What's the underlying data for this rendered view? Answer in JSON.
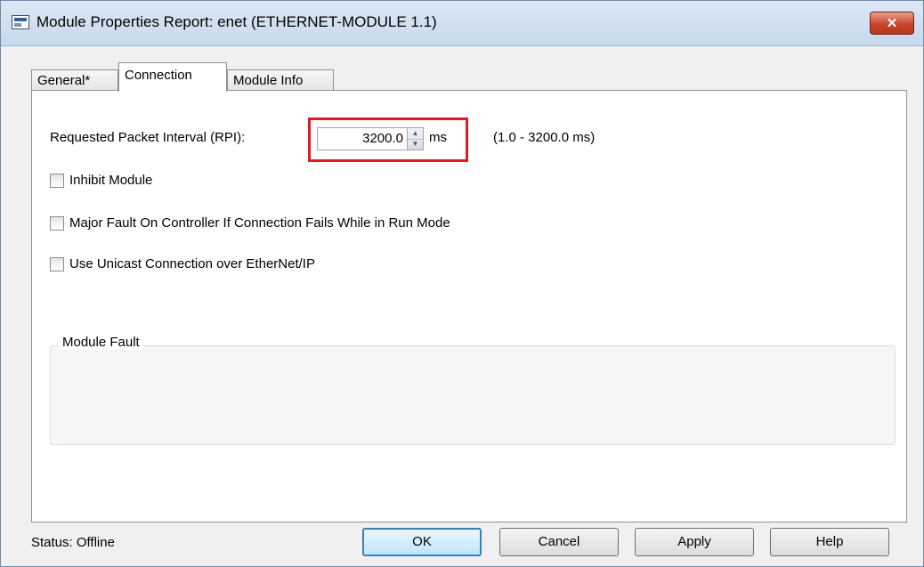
{
  "window": {
    "title": "Module Properties Report: enet (ETHERNET-MODULE 1.1)",
    "close_label": "✕"
  },
  "tabs": [
    {
      "label": "General*",
      "active": false
    },
    {
      "label": "Connection",
      "active": true
    },
    {
      "label": "Module Info",
      "active": false
    }
  ],
  "connection": {
    "rpi_label": "Requested Packet Interval (RPI):",
    "rpi_value": "3200.0",
    "rpi_unit": "ms",
    "rpi_range": "(1.0 - 3200.0 ms)",
    "checkboxes": [
      {
        "label": "Inhibit Module",
        "checked": false
      },
      {
        "label": "Major Fault On Controller If Connection Fails While in Run Mode",
        "checked": false
      },
      {
        "label": "Use Unicast Connection over EtherNet/IP",
        "checked": false
      }
    ],
    "module_fault_label": "Module Fault"
  },
  "footer": {
    "status_text": "Status:  Offline",
    "buttons": {
      "ok": "OK",
      "cancel": "Cancel",
      "apply": "Apply",
      "help": "Help"
    }
  },
  "colors": {
    "highlight": "#e21b23",
    "close_button": "#c8442b"
  }
}
